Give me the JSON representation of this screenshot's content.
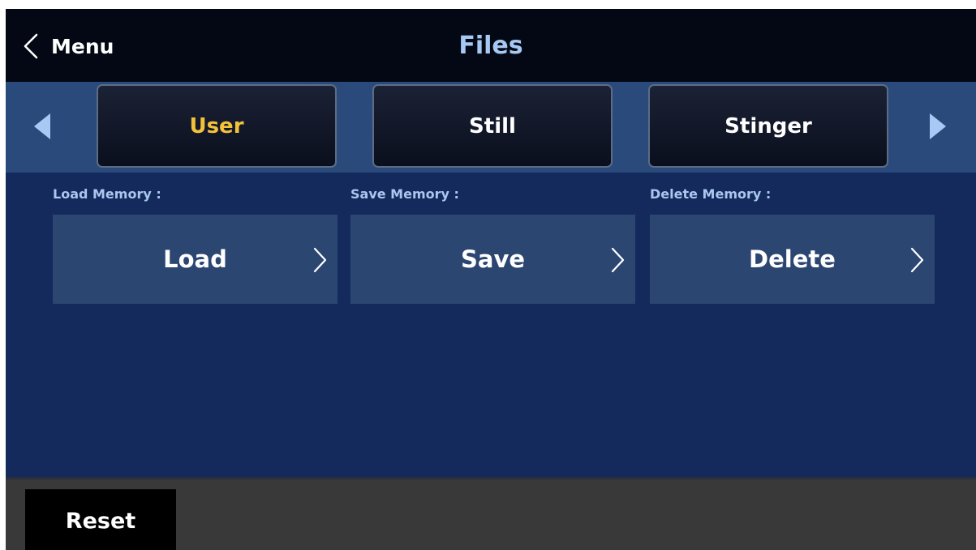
{
  "header": {
    "back_label": "Menu",
    "title": "Files"
  },
  "tabs": [
    {
      "label": "User",
      "active": true
    },
    {
      "label": "Still",
      "active": false
    },
    {
      "label": "Stinger",
      "active": false
    }
  ],
  "memory": {
    "load": {
      "label": "Load Memory :",
      "button": "Load"
    },
    "save": {
      "label": "Save Memory :",
      "button": "Save"
    },
    "delete": {
      "label": "Delete Memory :",
      "button": "Delete"
    }
  },
  "footer": {
    "reset_label": "Reset"
  },
  "icons": {
    "back": "chevron-left-icon",
    "prev": "triangle-left-icon",
    "next": "triangle-right-icon",
    "go": "chevron-right-icon"
  },
  "colors": {
    "active_tab_text": "#f3c23b",
    "title_text": "#a7c8f2",
    "section_label_text": "#a9c7ef",
    "background": "#142a5c",
    "arrow_fill": "#a9c9f5"
  }
}
